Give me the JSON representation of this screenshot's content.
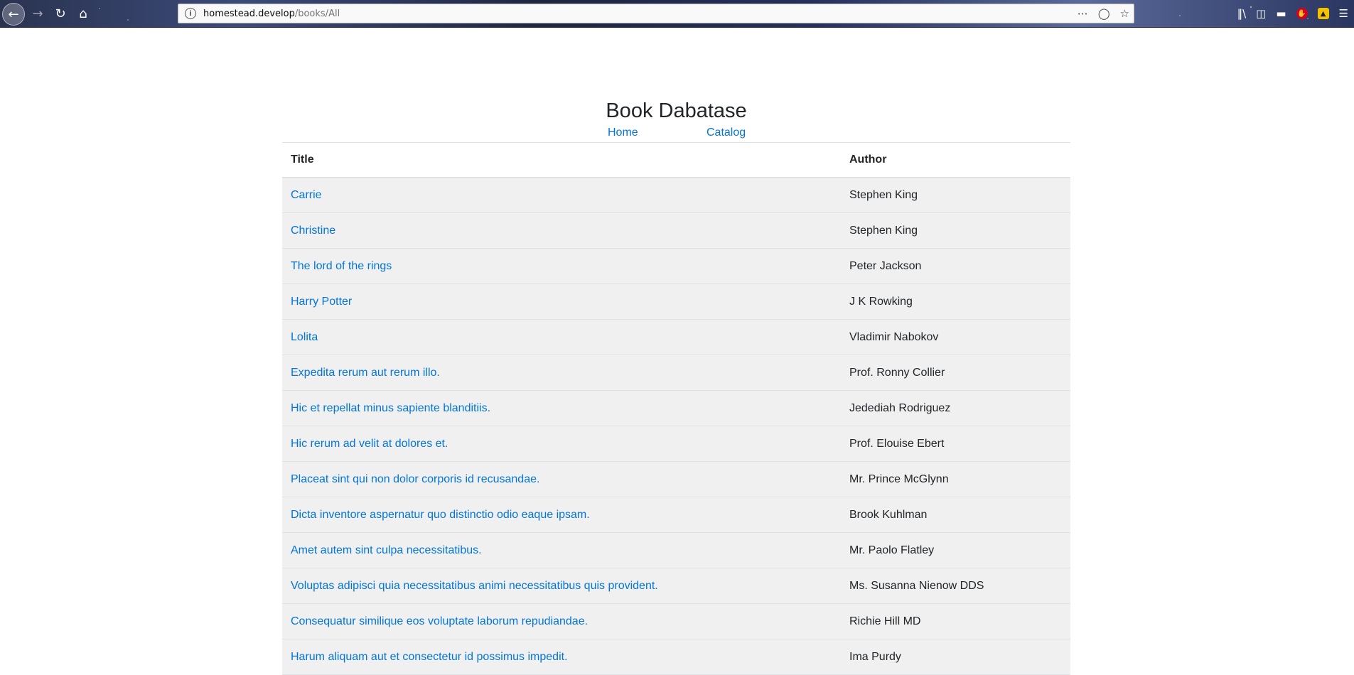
{
  "browser": {
    "url_host": "homestead.develop",
    "url_path": "/books/All",
    "icons": {
      "back": "back-arrow-icon",
      "forward": "forward-arrow-icon",
      "reload": "reload-icon",
      "home": "home-icon",
      "info": "site-info-icon",
      "page_actions": "ellipsis-icon",
      "pocket": "pocket-icon",
      "bookmark": "star-icon",
      "library": "library-icon",
      "sidebar": "sidebar-icon",
      "extension1": "extension-icon",
      "extension_red": "extension-red-icon",
      "extension_yellow": "extension-yellow-icon",
      "menu": "hamburger-menu-icon"
    }
  },
  "page": {
    "title": "Book Dabatase",
    "nav": {
      "home": "Home",
      "catalog": "Catalog"
    },
    "table": {
      "headers": {
        "title": "Title",
        "author": "Author"
      },
      "rows": [
        {
          "title": "Carrie",
          "author": "Stephen King"
        },
        {
          "title": "Christine",
          "author": "Stephen King"
        },
        {
          "title": "The lord of the rings",
          "author": "Peter Jackson"
        },
        {
          "title": "Harry Potter",
          "author": "J K Rowking"
        },
        {
          "title": "Lolita",
          "author": "Vladimir Nabokov"
        },
        {
          "title": "Expedita rerum aut rerum illo.",
          "author": "Prof. Ronny Collier"
        },
        {
          "title": "Hic et repellat minus sapiente blanditiis.",
          "author": "Jedediah Rodriguez"
        },
        {
          "title": "Hic rerum ad velit at dolores et.",
          "author": "Prof. Elouise Ebert"
        },
        {
          "title": "Placeat sint qui non dolor corporis id recusandae.",
          "author": "Mr. Prince McGlynn"
        },
        {
          "title": "Dicta inventore aspernatur quo distinctio odio eaque ipsam.",
          "author": "Brook Kuhlman"
        },
        {
          "title": "Amet autem sint culpa necessitatibus.",
          "author": "Mr. Paolo Flatley"
        },
        {
          "title": "Voluptas adipisci quia necessitatibus animi necessitatibus quis provident.",
          "author": "Ms. Susanna Nienow DDS"
        },
        {
          "title": "Consequatur similique eos voluptate laborum repudiandae.",
          "author": "Richie Hill MD"
        },
        {
          "title": "Harum aliquam aut et consectetur id possimus impedit.",
          "author": "Ima Purdy"
        }
      ]
    }
  },
  "colors": {
    "link": "#0275d8",
    "text": "#212529",
    "row_background": "#f0f0f0",
    "border": "#dee2e6"
  }
}
